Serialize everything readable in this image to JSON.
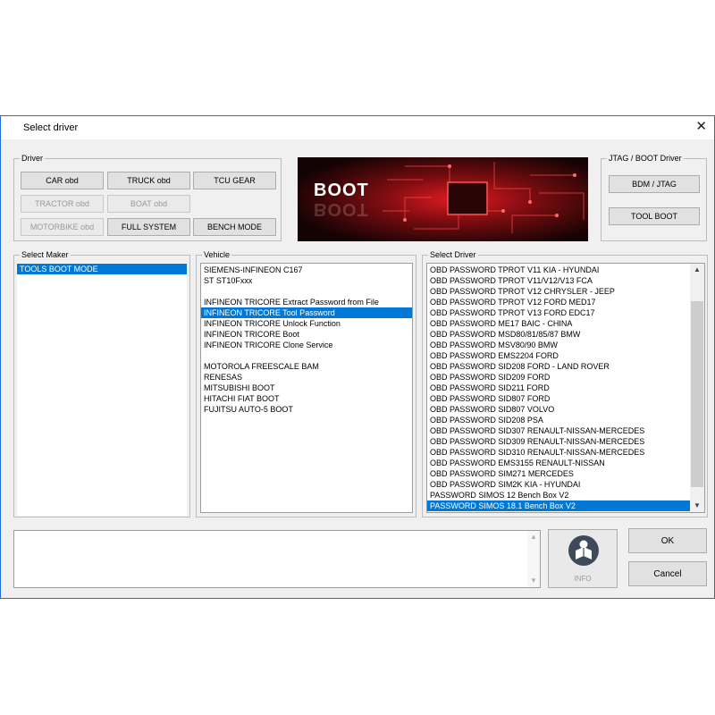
{
  "window": {
    "title": "Select driver"
  },
  "driver_group": {
    "label": "Driver",
    "buttons": [
      "CAR  obd",
      "TRUCK  obd",
      "TCU GEAR",
      "TRACTOR  obd",
      "BOAT  obd",
      "MOTORBIKE  obd",
      "FULL SYSTEM",
      "BENCH MODE"
    ]
  },
  "banner": {
    "text": "BOOT"
  },
  "jtag_group": {
    "label": "JTAG / BOOT Driver",
    "buttons": [
      "BDM / JTAG",
      "TOOL BOOT"
    ]
  },
  "maker": {
    "label": "Select Maker",
    "items": [
      "TOOLS BOOT MODE"
    ],
    "selected_index": 0
  },
  "vehicle": {
    "label": "Vehicle",
    "items": [
      "SIEMENS-INFINEON C167",
      "ST ST10Fxxx",
      "",
      "INFINEON TRICORE Extract Password from File",
      "INFINEON TRICORE Tool Password",
      "INFINEON TRICORE Unlock Function",
      "INFINEON TRICORE Boot",
      "INFINEON TRICORE Clone Service",
      "",
      "MOTOROLA FREESCALE BAM",
      "RENESAS",
      "MITSUBISHI BOOT",
      "HITACHI FIAT BOOT",
      "FUJITSU AUTO-5 BOOT"
    ],
    "selected_index": 4
  },
  "driver_list": {
    "label": "Select Driver",
    "items": [
      "OBD PASSWORD TPROT V11 KIA - HYUNDAI",
      "OBD PASSWORD TPROT V11/V12/V13 FCA",
      "OBD PASSWORD TPROT V12 CHRYSLER - JEEP",
      "OBD PASSWORD TPROT V12 FORD MED17",
      "OBD PASSWORD TPROT V13 FORD EDC17",
      "OBD PASSWORD ME17 BAIC - CHINA",
      "OBD PASSWORD MSD80/81/85/87 BMW",
      "OBD PASSWORD MSV80/90 BMW",
      "OBD PASSWORD EMS2204 FORD",
      "OBD PASSWORD SID208 FORD - LAND ROVER",
      "OBD PASSWORD SID209 FORD",
      "OBD PASSWORD SID211 FORD",
      "OBD PASSWORD SID807 FORD",
      "OBD PASSWORD SID807 VOLVO",
      "OBD PASSWORD SID208 PSA",
      "OBD PASSWORD SID307 RENAULT-NISSAN-MERCEDES",
      "OBD PASSWORD SID309 RENAULT-NISSAN-MERCEDES",
      "OBD PASSWORD SID310 RENAULT-NISSAN-MERCEDES",
      "OBD PASSWORD EMS3155 RENAULT-NISSAN",
      "OBD PASSWORD SIM271 MERCEDES",
      "OBD PASSWORD SIM2K KIA - HYUNDAI",
      "PASSWORD SIMOS 12 Bench Box V2",
      "PASSWORD SIMOS 18.1 Bench Box V2"
    ],
    "selected_index": 22
  },
  "footer": {
    "info_label": "INFO",
    "ok_label": "OK",
    "cancel_label": "Cancel"
  },
  "colors": {
    "selection": "#0078d7",
    "window_border": "#1e6fd9",
    "banner_red": "#c4161c"
  }
}
